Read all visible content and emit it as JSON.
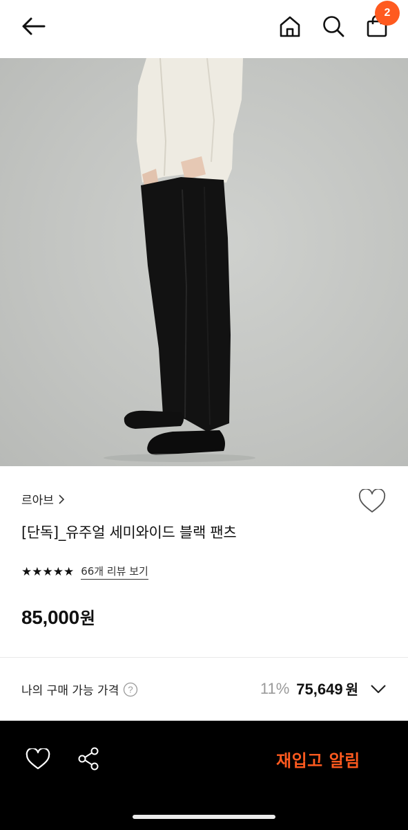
{
  "header": {
    "back_icon": "arrow-left-icon",
    "home_icon": "home-icon",
    "search_icon": "search-icon",
    "bag_icon": "shopping-bag-icon",
    "cart_count": "2",
    "badge_color": "#ff5a1f"
  },
  "product": {
    "image_alt_icon": "product-photo",
    "brand": "르아브",
    "title": "[단독]_유주얼 세미와이드 블랙 팬츠",
    "rating": 5,
    "rating_stars": "★★★★★",
    "review_link": "66개 리뷰 보기",
    "price_number": "85,000",
    "price_unit": "원"
  },
  "my_price": {
    "label": "나의 구매 가능 가격",
    "discount": "11%",
    "price_number": "75,649",
    "price_unit": "원"
  },
  "bottom_bar": {
    "restock_label": "재입고 알림",
    "accent": "#ff5a1f"
  }
}
